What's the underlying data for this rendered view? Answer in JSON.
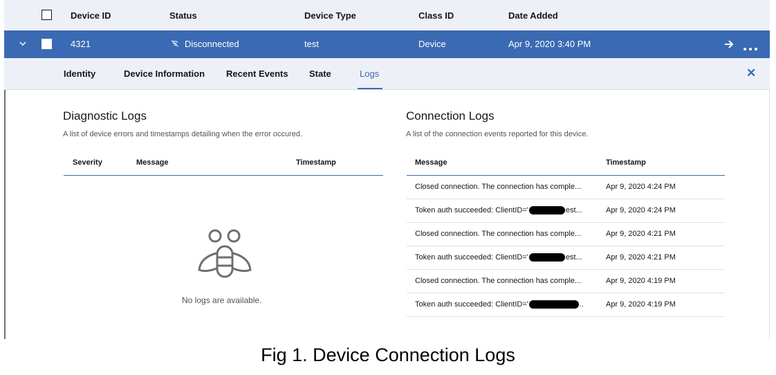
{
  "table_header": {
    "device_id": "Device ID",
    "status": "Status",
    "device_type": "Device Type",
    "class_id": "Class ID",
    "date_added": "Date Added"
  },
  "selected_row": {
    "device_id": "4321",
    "status": "Disconnected",
    "status_icon": "disconnected-icon",
    "device_type": "test",
    "class_id": "Device",
    "date_added": "Apr 9, 2020 3:40 PM",
    "checked": true
  },
  "tabs": [
    {
      "label": "Identity",
      "active": false
    },
    {
      "label": "Device Information",
      "active": false
    },
    {
      "label": "Recent Events",
      "active": false
    },
    {
      "label": "State",
      "active": false
    },
    {
      "label": "Logs",
      "active": true
    }
  ],
  "diagnostic_logs": {
    "title": "Diagnostic Logs",
    "description": "A list of device errors and timestamps detailing when the error occured.",
    "columns": [
      "Severity",
      "Message",
      "Timestamp"
    ],
    "empty_text": "No logs are available."
  },
  "connection_logs": {
    "title": "Connection Logs",
    "description": "A list of the connection events reported for this device.",
    "columns": [
      "Message",
      "Timestamp"
    ],
    "rows": [
      {
        "message": "Closed connection. The connection has comple...",
        "timestamp": "Apr 9, 2020 4:24 PM"
      },
      {
        "message_prefix": "Token auth succeeded: ClientID='",
        "message_suffix": "est...",
        "timestamp": "Apr 9, 2020 4:24 PM"
      },
      {
        "message": "Closed connection. The connection has comple...",
        "timestamp": "Apr 9, 2020 4:21 PM"
      },
      {
        "message_prefix": "Token auth succeeded: ClientID='",
        "message_suffix": "est...",
        "timestamp": "Apr 9, 2020 4:21 PM"
      },
      {
        "message": "Closed connection. The connection has comple...",
        "timestamp": "Apr 9, 2020 4:19 PM"
      },
      {
        "message_prefix": "Token auth succeeded: ClientID='",
        "message_suffix": "..",
        "timestamp": "Apr 9, 2020 4:19 PM"
      }
    ]
  },
  "caption": "Fig 1. Device Connection Logs",
  "colors": {
    "accent": "#3a6ab3",
    "header_bg": "#eef0f8"
  }
}
